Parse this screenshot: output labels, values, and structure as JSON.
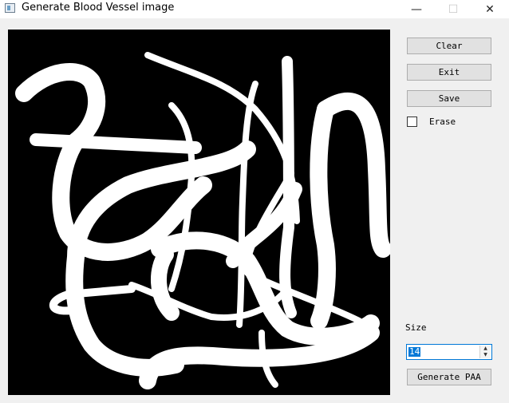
{
  "window": {
    "title": "Generate Blood Vessel image",
    "minimize_glyph": "—",
    "maximize_glyph": "☐",
    "close_glyph": "✕"
  },
  "buttons": {
    "clear": "Clear",
    "exit": "Exit",
    "save": "Save",
    "generate": "Generate PAA"
  },
  "erase": {
    "label": "Erase",
    "checked": false
  },
  "size": {
    "label": "Size",
    "value": "14"
  },
  "icons": {
    "app": "app-icon",
    "spin_up": "▲",
    "spin_down": "▼"
  }
}
